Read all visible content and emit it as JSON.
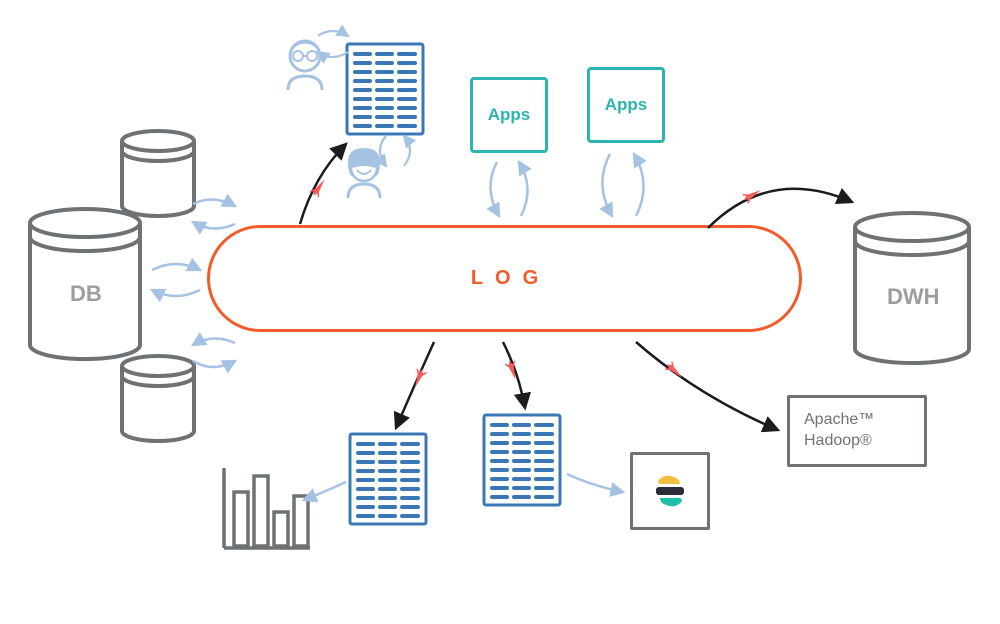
{
  "center": {
    "label": "LOG"
  },
  "db": {
    "label": "DB"
  },
  "dwh": {
    "label": "DWH"
  },
  "apps": {
    "label1": "Apps",
    "label2": "Apps"
  },
  "hadoop": {
    "line1": "Apache™",
    "line2": "Hadoop®"
  }
}
